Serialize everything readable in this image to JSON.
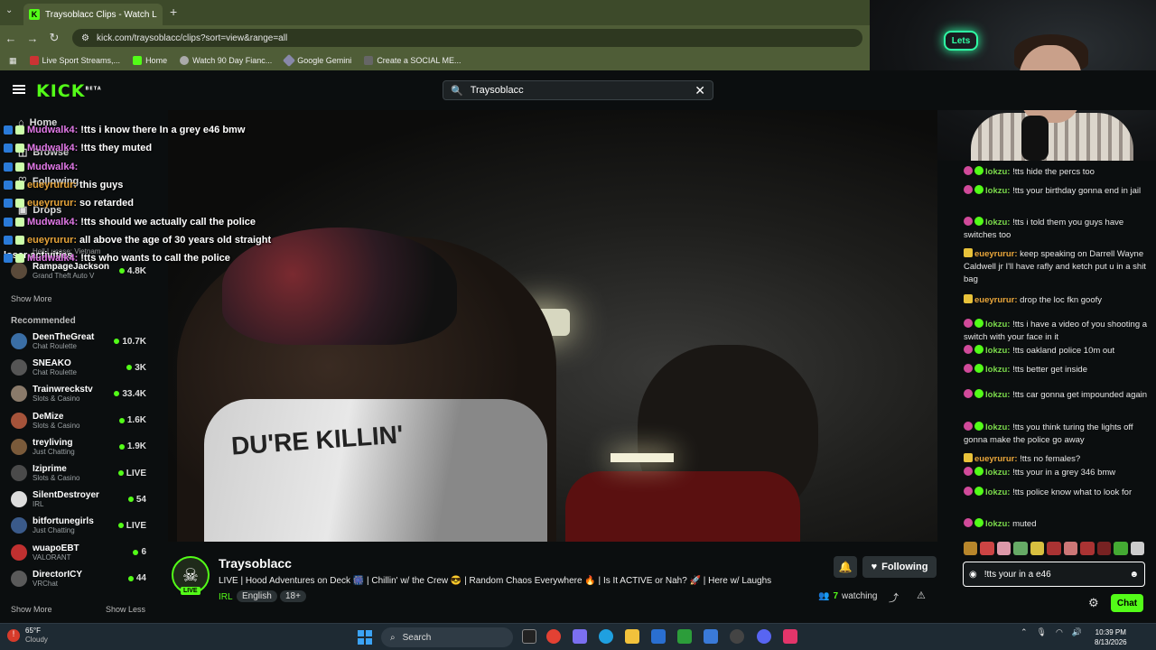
{
  "browser": {
    "tab_title": "Traysoblacc Clips - Watch L",
    "url": "kick.com/traysoblacc/clips?sort=view&range=all",
    "bookmarks": [
      "Live Sport Streams,...",
      "Home",
      "Watch 90 Day Fianc...",
      "Google Gemini",
      "Create a SOCIAL ME..."
    ]
  },
  "webcam": {
    "neon_text": "Lets"
  },
  "kick": {
    "logo": "KICK",
    "beta": "BETA",
    "search_value": "Traysoblacc"
  },
  "sidebar": {
    "nav": [
      "Home",
      "Browse",
      "Following",
      "Drops"
    ],
    "following_partial": [
      {
        "name": "Hell Lucase: Vietnam",
        "category": ""
      },
      {
        "name": "RampageJackson",
        "category": "Grand Theft Auto V",
        "viewers": "4.8K"
      }
    ],
    "loser_text": "loser activities",
    "show_more_top": "Show More",
    "recommended_title": "Recommended",
    "recommended": [
      {
        "name": "DeenTheGreat",
        "category": "Chat Roulette",
        "viewers": "10.7K",
        "color": "#3a6ea5"
      },
      {
        "name": "SNEAKO",
        "category": "Chat Roulette",
        "viewers": "3K",
        "color": "#555"
      },
      {
        "name": "Trainwreckstv",
        "category": "Slots & Casino",
        "viewers": "33.4K",
        "color": "#8a7a6a"
      },
      {
        "name": "DeMize",
        "category": "Slots & Casino",
        "viewers": "1.6K",
        "color": "#a5533a"
      },
      {
        "name": "treyliving",
        "category": "Just Chatting",
        "viewers": "1.9K",
        "color": "#7a5a3a"
      },
      {
        "name": "Iziprime",
        "category": "Slots & Casino",
        "viewers": "LIVE",
        "color": "#4a4a4a"
      },
      {
        "name": "SilentDestroyer",
        "category": "IRL",
        "viewers": "54",
        "color": "#ddd"
      },
      {
        "name": "bitfortunegirls",
        "category": "Just Chatting",
        "viewers": "LIVE",
        "color": "#3a5a8a"
      },
      {
        "name": "wuapoEBT",
        "category": "VALORANT",
        "viewers": "6",
        "color": "#c03030"
      },
      {
        "name": "DirectorICY",
        "category": "VRChat",
        "viewers": "44",
        "color": "#5a5a5a"
      }
    ],
    "show_more_bottom": "Show More",
    "show_less": "Show Less"
  },
  "overlay_chat": [
    {
      "user": "Mudwalk4:",
      "text": "!tts i know there In a grey e46 bmw",
      "type": "u1"
    },
    {
      "user": "Mudwalk4:",
      "text": "!tts they muted",
      "type": "u1"
    },
    {
      "user": "Mudwalk4:",
      "text": "",
      "type": "u1"
    },
    {
      "user": "eueyrurur:",
      "text": "this guys",
      "type": "u2"
    },
    {
      "user": "eueyrurur:",
      "text": "so retarded",
      "type": "u2"
    },
    {
      "user": "Mudwalk4:",
      "text": "!tts should we actually call the police",
      "type": "u1"
    },
    {
      "user": "eueyrurur:",
      "text": "all above the age of 30 years old straight",
      "type": "u2"
    },
    {
      "user": "Mudwalk4:",
      "text": "!tts who wants to call the police",
      "type": "u1"
    }
  ],
  "video": {
    "jacket_text": "DU'RE KILLIN'"
  },
  "stream": {
    "name": "Traysoblacc",
    "live_badge": "LIVE",
    "title": "LIVE | Hood Adventures on Deck 🎆 | Chillin' w/ the Crew 😎 | Random Chaos Everywhere 🔥 | Is It ACTIVE or Nah? 🚀 | Here w/ Laughs",
    "category": "IRL",
    "tags": [
      "English",
      "18+"
    ],
    "following_label": "Following",
    "watching_count": "7",
    "watching_label": "watching"
  },
  "chat": [
    {
      "user": "lokzu:",
      "text": "!tts hide the percs too",
      "badges": [
        "pink",
        "green"
      ],
      "utype": "lk"
    },
    {
      "user": "lokzu:",
      "text": "!tts your birthday gonna end in jail",
      "badges": [
        "pink",
        "green"
      ],
      "utype": "lk"
    },
    {
      "user": "lokzu:",
      "text": "!tts i told them you guys have switches too",
      "badges": [
        "pink",
        "green"
      ],
      "utype": "lk"
    },
    {
      "user": "eueyrurur:",
      "text": "keep speaking on Darrell Wayne Caldwell jr I'll have rafly and ketch put u in a shit bag",
      "badges": [
        "gold"
      ],
      "utype": "eu"
    },
    {
      "user": "eueyrurur:",
      "text": "drop the loc fkn goofy",
      "badges": [
        "gold"
      ],
      "utype": "eu"
    },
    {
      "user": "lokzu:",
      "text": "!tts i have a video of you shooting a switch with your face in it",
      "badges": [
        "pink",
        "green"
      ],
      "utype": "lk"
    },
    {
      "user": "lokzu:",
      "text": "!tts oakland police 10m out",
      "badges": [
        "pink",
        "green"
      ],
      "utype": "lk"
    },
    {
      "user": "lokzu:",
      "text": "!tts better get inside",
      "badges": [
        "pink",
        "green"
      ],
      "utype": "lk"
    },
    {
      "user": "lokzu:",
      "text": "!tts car gonna get impounded again",
      "badges": [
        "pink",
        "green"
      ],
      "utype": "lk"
    },
    {
      "user": "lokzu:",
      "text": "!tts you think turing the lights off gonna make the police go away",
      "badges": [
        "pink",
        "green"
      ],
      "utype": "lk"
    },
    {
      "user": "eueyrurur:",
      "text": "!tts no females?",
      "badges": [
        "gold"
      ],
      "utype": "eu"
    },
    {
      "user": "lokzu:",
      "text": "!tts your in a grey 346 bmw",
      "badges": [
        "pink",
        "green"
      ],
      "utype": "lk"
    },
    {
      "user": "lokzu:",
      "text": "!tts police know what to look for",
      "badges": [
        "pink",
        "green"
      ],
      "utype": "lk"
    },
    {
      "user": "lokzu:",
      "text": "muted",
      "badges": [
        "pink",
        "green"
      ],
      "utype": "lk"
    }
  ],
  "chat_input": {
    "value": "!tts your in a e46",
    "send_label": "Chat"
  },
  "taskbar": {
    "temp": "65°F",
    "weather": "Cloudy",
    "search_label": "Search",
    "time": "10:39 PM",
    "date": "8/13/2026"
  },
  "colors": {
    "kick_green": "#53fc18",
    "chrome": "#4f5d37",
    "bg": "#0b0e0f"
  }
}
